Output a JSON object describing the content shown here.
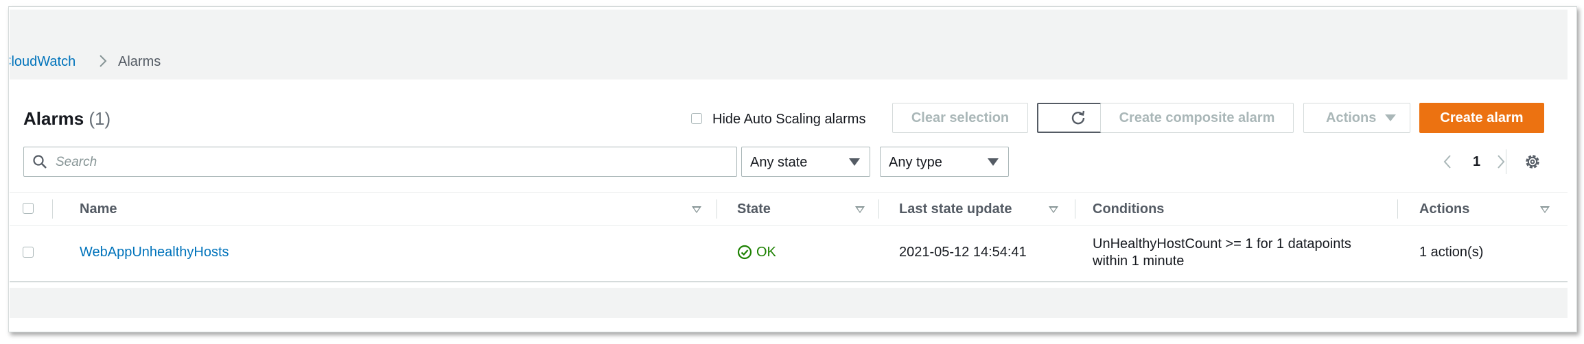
{
  "breadcrumb": {
    "root": "CloudWatch",
    "current": "Alarms"
  },
  "header": {
    "title": "Alarms",
    "count": "(1)",
    "hide_autoscaling_label": "Hide Auto Scaling alarms",
    "clear_selection": "Clear selection",
    "create_composite": "Create composite alarm",
    "actions": "Actions",
    "create_alarm": "Create alarm"
  },
  "filters": {
    "search_placeholder": "Search",
    "state_value": "Any state",
    "type_value": "Any type"
  },
  "pagination": {
    "page": "1"
  },
  "table": {
    "columns": [
      "Name",
      "State",
      "Last state update",
      "Conditions",
      "Actions"
    ],
    "rows": [
      {
        "name": "WebAppUnhealthyHosts",
        "state": "OK",
        "last_update": "2021-05-12 14:54:41",
        "conditions_line1": "UnHealthyHostCount >= 1 for 1 datapoints",
        "conditions_line2": "within 1 minute",
        "actions": "1 action(s)"
      }
    ]
  },
  "colors": {
    "link": "#0073bb",
    "primary": "#ec7211",
    "ok": "#1d8102"
  }
}
